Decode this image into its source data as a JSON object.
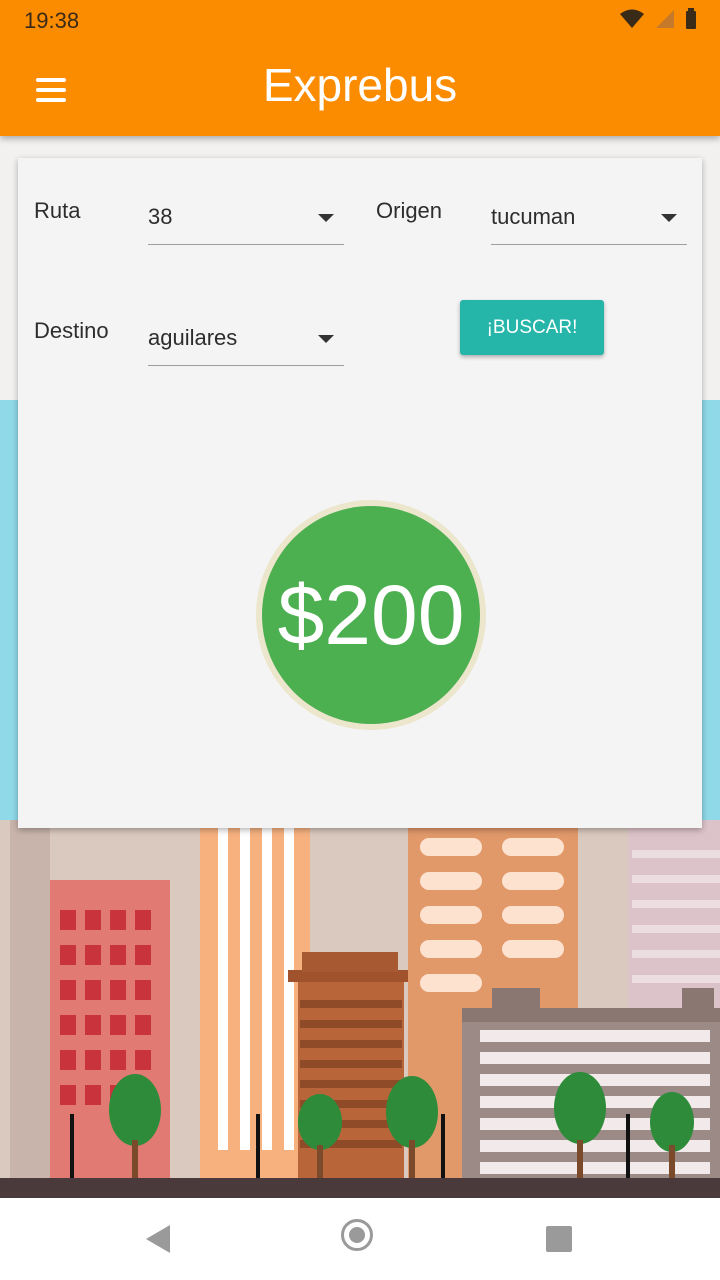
{
  "status_bar": {
    "time": "19:38"
  },
  "app_bar": {
    "title": "Exprebus"
  },
  "form": {
    "ruta_label": "Ruta",
    "ruta_value": "38",
    "origen_label": "Origen",
    "origen_value": "tucuman",
    "destino_label": "Destino",
    "destino_value": "aguilares",
    "search_button_label": "¡BUSCAR!"
  },
  "result": {
    "price": "$200"
  },
  "colors": {
    "app_bar": "#fb8c00",
    "button": "#26b5a9",
    "price_circle": "#4caf50"
  },
  "icons": [
    "menu-icon",
    "wifi-icon",
    "signal-icon",
    "battery-icon",
    "back-icon",
    "home-icon",
    "recent-apps-icon"
  ]
}
